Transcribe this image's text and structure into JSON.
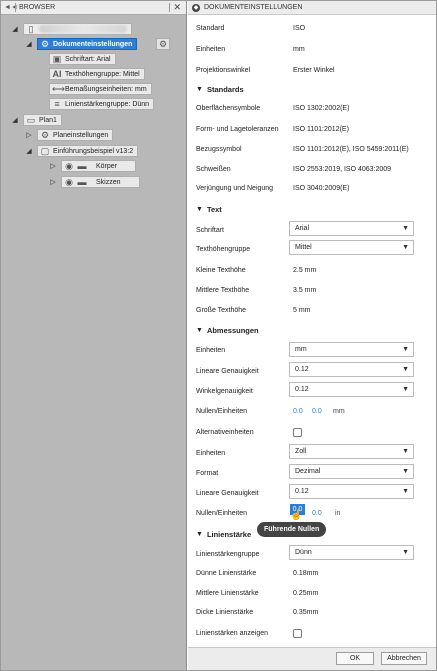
{
  "browser": {
    "title": "BROWSER",
    "tree": {
      "doc_settings": "Dokumenteinstellungen",
      "font": "Schriftart: Arial",
      "text_height_group": "Texthöhengruppe: Mittel",
      "dim_units": "Bemaßungseinheiten: mm",
      "line_weight_group": "Linienstärkengruppe: Dünn",
      "sheet": "Plan1",
      "sheet_settings": "Planeinstellungen",
      "intro": "Einführungsbeispiel v13:2",
      "bodies": "Körper",
      "sketches": "Skizzen"
    }
  },
  "settings": {
    "title": "DOKUMENTEINSTELLUNGEN",
    "top_rows": [
      {
        "label": "Standard",
        "value": "ISO"
      },
      {
        "label": "Einheiten",
        "value": "mm"
      },
      {
        "label": "Projektionswinkel",
        "value": "Erster Winkel"
      }
    ],
    "standards": {
      "title": "Standards",
      "rows": [
        {
          "label": "Oberflächensymbole",
          "value": "ISO 1302:2002(E)"
        },
        {
          "label": "Form- und Lagetoleranzen",
          "value": "ISO 1101:2012(E)"
        },
        {
          "label": "Bezugssymbol",
          "value": "ISO 1101:2012(E), ISO 5459:2011(E)"
        },
        {
          "label": "Schweißen",
          "value": "ISO 2553:2019, ISO 4063:2009"
        },
        {
          "label": "Verjüngung und Neigung",
          "value": "ISO 3040:2009(E)"
        }
      ]
    },
    "text": {
      "title": "Text",
      "font_label": "Schriftart",
      "font_value": "Arial",
      "group_label": "Texthöhengruppe",
      "group_value": "Mittel",
      "small_label": "Kleine Texthöhe",
      "small_value": "2.5 mm",
      "mid_label": "Mittlere Texthöhe",
      "mid_value": "3.5 mm",
      "large_label": "Große Texthöhe",
      "large_value": "5 mm"
    },
    "dims": {
      "title": "Abmessungen",
      "units_label": "Einheiten",
      "units_value": "mm",
      "lin_label": "Lineare Genauigkeit",
      "lin_value": "0.12",
      "ang_label": "Winkelgenauigkeit",
      "ang_value": "0.12",
      "zeros_label": "Nullen/Einheiten",
      "zero1": "0.0",
      "zero2": "0.0",
      "zero_unit": "mm",
      "alt_label": "Alternativeinheiten",
      "alt_units_label": "Einheiten",
      "alt_units_value": "Zoll",
      "format_label": "Format",
      "format_value": "Dezimal",
      "alt_lin_label": "Lineare Genauigkeit",
      "alt_lin_value": "0.12",
      "alt_zeros_label": "Nullen/Einheiten",
      "alt_zero1": "0.0",
      "alt_zero2": "0.0",
      "alt_zero_unit": "in",
      "tooltip": "Führende Nullen"
    },
    "lines": {
      "title": "Linienstärke",
      "group_label": "Linienstärkengruppe",
      "group_value": "Dünn",
      "thin_label": "Dünne Linienstärke",
      "thin_value": "0.18mm",
      "mid_label": "Mittlere Linienstärke",
      "mid_value": "0.25mm",
      "thick_label": "Dicke Linienstärke",
      "thick_value": "0.35mm",
      "show_label": "Linienstärken anzeigen"
    },
    "ok": "OK",
    "cancel": "Abbrechen"
  }
}
